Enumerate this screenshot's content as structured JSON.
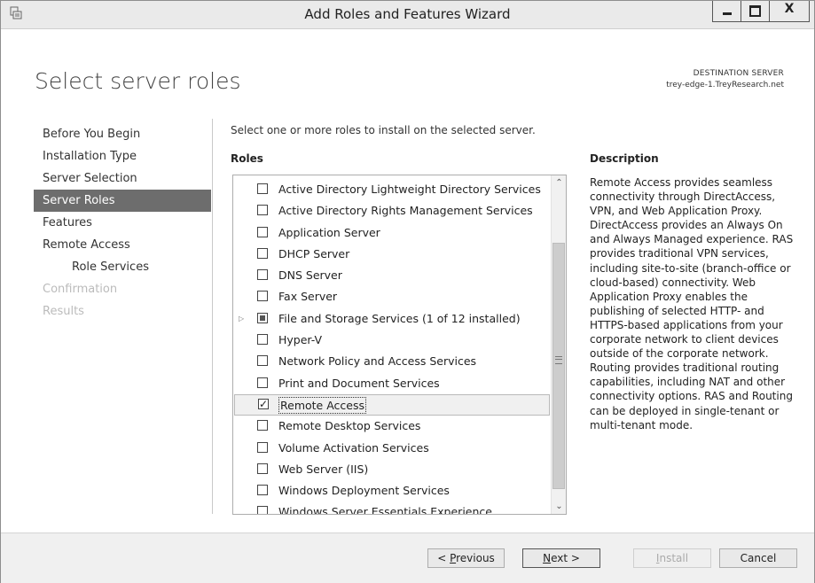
{
  "window": {
    "title": "Add Roles and Features Wizard",
    "minimize_glyph": "",
    "maximize_glyph": "",
    "close_glyph": "X"
  },
  "header": {
    "page_title": "Select server roles",
    "destination_label": "DESTINATION SERVER",
    "destination_value": "trey-edge-1.TreyResearch.net"
  },
  "nav": {
    "items": [
      {
        "label": "Before You Begin",
        "state": "normal"
      },
      {
        "label": "Installation Type",
        "state": "normal"
      },
      {
        "label": "Server Selection",
        "state": "normal"
      },
      {
        "label": "Server Roles",
        "state": "active"
      },
      {
        "label": "Features",
        "state": "normal"
      },
      {
        "label": "Remote Access",
        "state": "normal"
      },
      {
        "label": "Role Services",
        "state": "sub"
      },
      {
        "label": "Confirmation",
        "state": "disabled"
      },
      {
        "label": "Results",
        "state": "disabled"
      }
    ]
  },
  "main": {
    "instruction": "Select one or more roles to install on the selected server.",
    "roles_heading": "Roles",
    "roles": [
      {
        "label": "Active Directory Lightweight Directory Services",
        "checked": false
      },
      {
        "label": "Active Directory Rights Management Services",
        "checked": false
      },
      {
        "label": "Application Server",
        "checked": false
      },
      {
        "label": "DHCP Server",
        "checked": false
      },
      {
        "label": "DNS Server",
        "checked": false
      },
      {
        "label": "Fax Server",
        "checked": false
      },
      {
        "label": "File and Storage Services (1 of 12 installed)",
        "checked": "partial",
        "expandable": true
      },
      {
        "label": "Hyper-V",
        "checked": false
      },
      {
        "label": "Network Policy and Access Services",
        "checked": false
      },
      {
        "label": "Print and Document Services",
        "checked": false
      },
      {
        "label": "Remote Access",
        "checked": true,
        "selected": true
      },
      {
        "label": "Remote Desktop Services",
        "checked": false
      },
      {
        "label": "Volume Activation Services",
        "checked": false
      },
      {
        "label": "Web Server (IIS)",
        "checked": false
      },
      {
        "label": "Windows Deployment Services",
        "checked": false
      },
      {
        "label": "Windows Server Essentials Experience",
        "checked": false
      }
    ],
    "scroll_position": 0.5,
    "description_heading": "Description",
    "description_text": "Remote Access provides seamless connectivity through DirectAccess, VPN, and Web Application Proxy. DirectAccess provides an Always On and Always Managed experience. RAS provides traditional VPN services, including site-to-site (branch-office or cloud-based) connectivity. Web Application Proxy enables the publishing of selected HTTP- and HTTPS-based applications from your corporate network to client devices outside of the corporate network. Routing provides traditional routing capabilities, including NAT and other connectivity options. RAS and Routing can be deployed in single-tenant or multi-tenant mode."
  },
  "footer": {
    "previous_prefix": "< ",
    "previous_key": "P",
    "previous_rest": "revious",
    "next_key": "N",
    "next_rest": "ext >",
    "install_key": "I",
    "install_rest": "nstall",
    "cancel_label": "Cancel"
  }
}
